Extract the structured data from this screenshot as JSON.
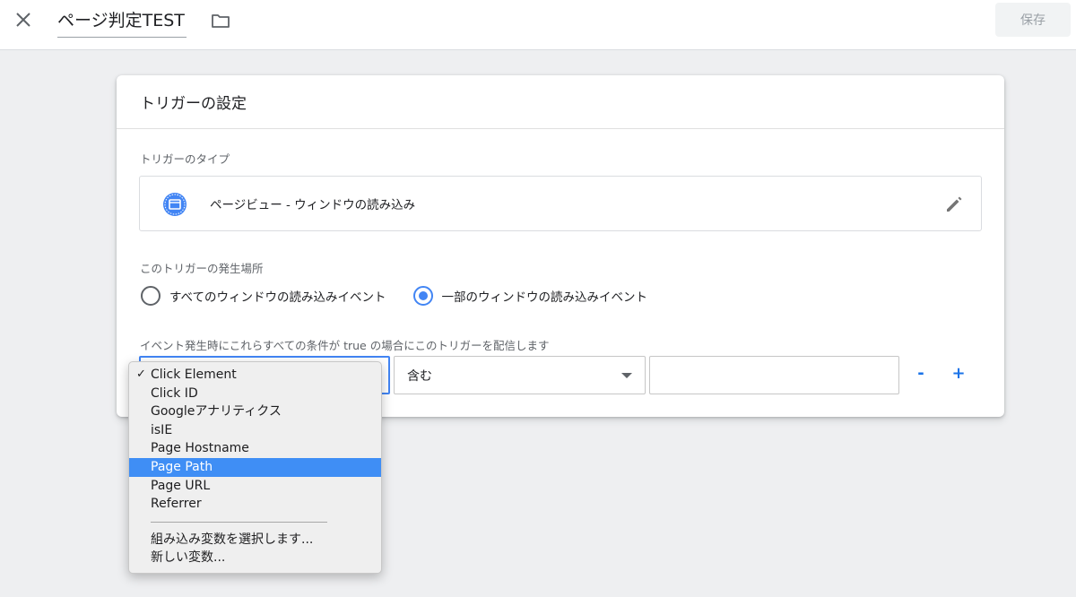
{
  "topbar": {
    "title": "ページ判定TEST",
    "save_label": "保存"
  },
  "card": {
    "header": "トリガーの設定",
    "trigger_type_label": "トリガーのタイプ",
    "trigger_type_value": "ページビュー - ウィンドウの読み込み",
    "fires_on_label": "このトリガーの発生場所",
    "radio_options": [
      {
        "label": "すべてのウィンドウの読み込みイベント",
        "checked": false
      },
      {
        "label": "一部のウィンドウの読み込みイベント",
        "checked": true
      }
    ],
    "condition_label": "イベント発生時にこれらすべての条件が true の場合にこのトリガーを配信します",
    "operator_value": "含む",
    "value_input": "",
    "minus_label": "-",
    "plus_label": "+"
  },
  "dropdown": {
    "items": [
      {
        "label": "Click Element",
        "checked": true,
        "highlight": false
      },
      {
        "label": "Click ID",
        "checked": false,
        "highlight": false
      },
      {
        "label": "Googleアナリティクス",
        "checked": false,
        "highlight": false
      },
      {
        "label": "isIE",
        "checked": false,
        "highlight": false
      },
      {
        "label": "Page Hostname",
        "checked": false,
        "highlight": false
      },
      {
        "label": "Page Path",
        "checked": false,
        "highlight": true
      },
      {
        "label": "Page URL",
        "checked": false,
        "highlight": false
      },
      {
        "label": "Referrer",
        "checked": false,
        "highlight": false
      }
    ],
    "extra_items": [
      {
        "label": "組み込み変数を選択します..."
      },
      {
        "label": "新しい変数..."
      }
    ],
    "check_glyph": "✓"
  },
  "colors": {
    "accent": "#4285f4",
    "highlight": "#3f8ef5",
    "background": "#eeeff1"
  },
  "icons": [
    "close-icon",
    "folder-icon",
    "page-view-icon",
    "pencil-icon"
  ]
}
